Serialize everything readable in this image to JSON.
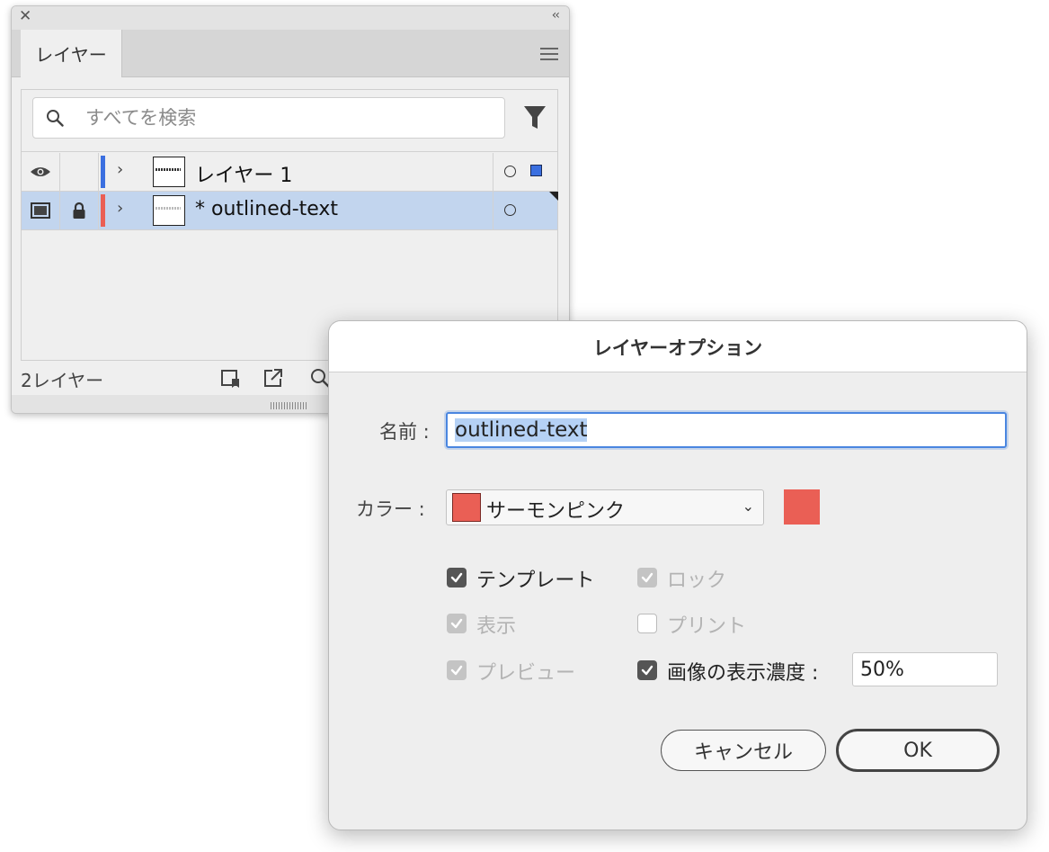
{
  "layers_panel": {
    "collapse_glyph": "‹‹",
    "tab_label": "レイヤー",
    "search_placeholder": "すべてを検索",
    "layers": [
      {
        "name": "レイヤー 1",
        "color": "#3b6fe0",
        "visible": true,
        "locked": false,
        "selected": false
      },
      {
        "name": "* outlined-text",
        "color": "#ea5f55",
        "visible": "template",
        "locked": true,
        "selected": true
      }
    ],
    "footer_count": "2レイヤー"
  },
  "dialog": {
    "title": "レイヤーオプション",
    "name_label": "名前 :",
    "name_value": "outlined-text",
    "color_label": "カラー :",
    "color_value": "サーモンピンク",
    "color_hex": "#ea5f55",
    "options": {
      "template": {
        "label": "テンプレート",
        "checked": true,
        "enabled": true
      },
      "lock": {
        "label": "ロック",
        "checked": true,
        "enabled": false
      },
      "show": {
        "label": "表示",
        "checked": true,
        "enabled": false
      },
      "print": {
        "label": "プリント",
        "checked": false,
        "enabled": false
      },
      "preview": {
        "label": "プレビュー",
        "checked": true,
        "enabled": false
      },
      "dim_images": {
        "label": "画像の表示濃度 :",
        "checked": true,
        "enabled": true,
        "value": "50%"
      }
    },
    "cancel_label": "キャンセル",
    "ok_label": "OK"
  }
}
